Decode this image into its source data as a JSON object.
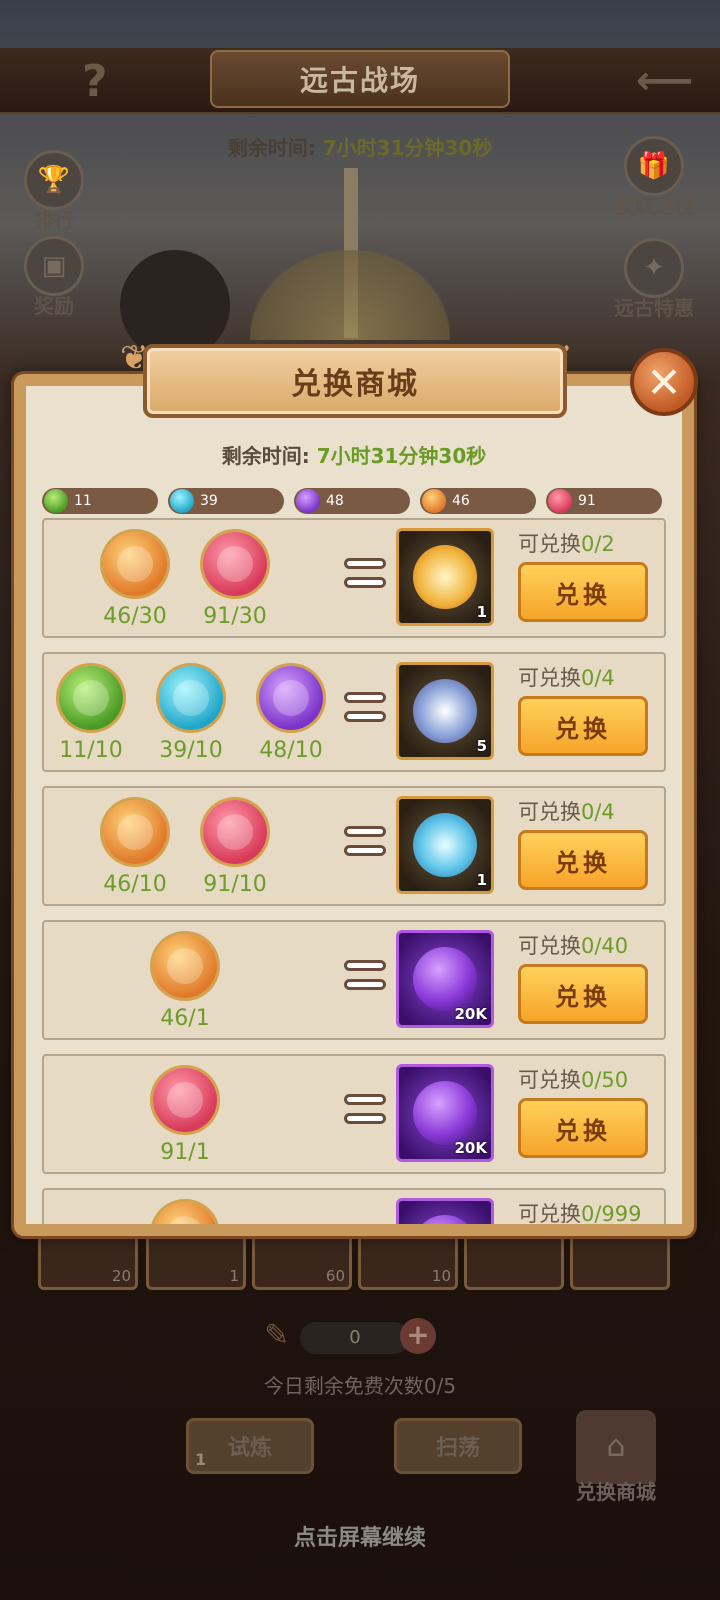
{
  "scene": {
    "title": "远古战场",
    "remaining_label": "剩余时间:",
    "remaining_value": "7小时31分钟30秒",
    "left_buttons": [
      {
        "label": "排行"
      },
      {
        "label": "奖励"
      }
    ],
    "right_buttons": [
      {
        "label": "获取途径"
      },
      {
        "label": "远古特惠"
      }
    ],
    "strip_counts": [
      "20",
      "1",
      "60",
      "10"
    ],
    "currency_value": "0",
    "free_times": "今日剩余免费次数0/5",
    "trial_label": "试炼",
    "trial_count": "1",
    "sweep_label": "扫荡",
    "shop_label": "兑换商城",
    "continue_hint": "点击屏幕继续"
  },
  "dialog": {
    "title": "兑换商城",
    "remaining_label": "剩余时间:",
    "remaining_value": "7小时31分钟30秒",
    "currencies": [
      {
        "color": "green",
        "amount": "11"
      },
      {
        "color": "cyan",
        "amount": "39"
      },
      {
        "color": "purple",
        "amount": "48"
      },
      {
        "color": "orange",
        "amount": "46"
      },
      {
        "color": "pink",
        "amount": "91"
      }
    ],
    "limit_label": "可兑换",
    "exchange_label": "兑换",
    "rows": [
      {
        "costs": [
          {
            "color": "orange",
            "text": "46/30"
          },
          {
            "color": "pink",
            "text": "91/30"
          }
        ],
        "reward": {
          "icon": "golden-orb-icon",
          "qty": "1"
        },
        "limit": "0/2"
      },
      {
        "costs": [
          {
            "color": "green",
            "text": "11/10"
          },
          {
            "color": "cyan",
            "text": "39/10"
          },
          {
            "color": "purple",
            "text": "48/10"
          }
        ],
        "reward": {
          "icon": "astrolabe-icon",
          "qty": "5"
        },
        "limit": "0/4"
      },
      {
        "costs": [
          {
            "color": "orange",
            "text": "46/10"
          },
          {
            "color": "pink",
            "text": "91/10"
          }
        ],
        "reward": {
          "icon": "crystal-star-icon",
          "qty": "1"
        },
        "limit": "0/4"
      },
      {
        "costs": [
          {
            "color": "orange",
            "text": "46/1"
          }
        ],
        "reward": {
          "icon": "purple-orb-icon",
          "qty": "20K"
        },
        "limit": "0/40"
      },
      {
        "costs": [
          {
            "color": "pink",
            "text": "91/1"
          }
        ],
        "reward": {
          "icon": "purple-orb-icon",
          "qty": "20K"
        },
        "limit": "0/50"
      },
      {
        "costs": [
          {
            "color": "orange",
            "text": ""
          }
        ],
        "reward": {
          "icon": "purple-orb-icon",
          "qty": ""
        },
        "limit": "0/999"
      }
    ]
  },
  "colors": {
    "accent_green": "#6c9c2a",
    "button_orange": "#f6a42a",
    "frame_brown": "#c99a5b"
  }
}
